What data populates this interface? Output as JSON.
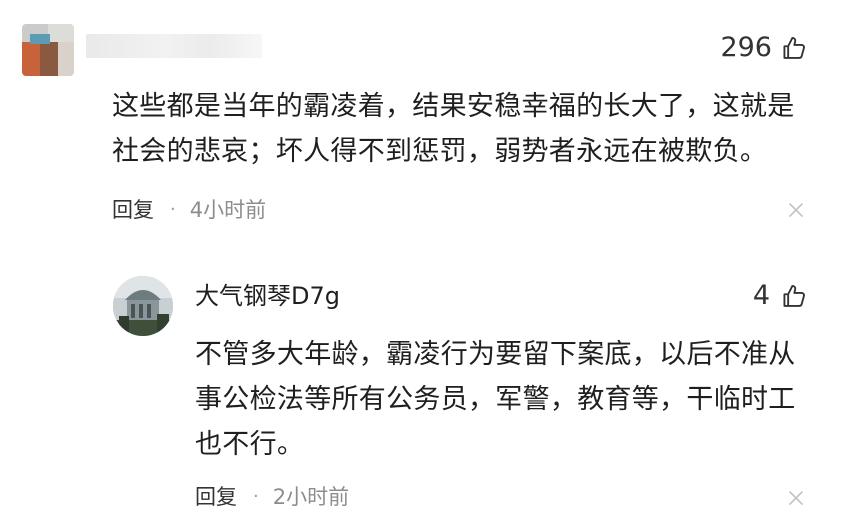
{
  "top_comment": {
    "like_count": "296",
    "text_lines": [
      "这些都是当年的霸凌着，结果安稳幸福的长大了，这就是",
      "社会的悲哀；坏人得不到惩罚，弱势者永远在被欺负。"
    ],
    "reply_label": "回复",
    "separator": "·",
    "time": "4小时前"
  },
  "reply_comment": {
    "author": "大气钢琴D7g",
    "like_count": "4",
    "text_lines": [
      "不管多大年龄，霸凌行为要留下案底，以后不准从",
      "事公检法等所有公务员，军警，教育等，干临时工",
      "也不行。"
    ],
    "reply_label": "回复",
    "separator": "·",
    "time": "2小时前"
  },
  "icons": {
    "like": "thumbs-up-icon",
    "close": "close-icon",
    "avatar": "avatar"
  },
  "colors": {
    "text": "#1f1f1f",
    "muted": "#8d8d8d",
    "icon": "#333333"
  }
}
